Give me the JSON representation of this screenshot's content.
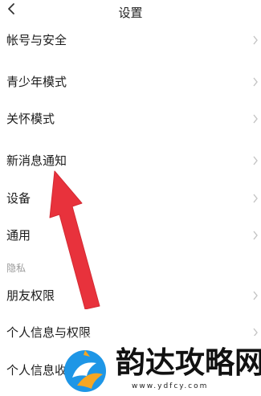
{
  "header": {
    "title": "设置"
  },
  "items": [
    {
      "label": "帐号与安全"
    },
    {
      "label": "青少年模式"
    },
    {
      "label": "关怀模式"
    },
    {
      "label": "新消息通知"
    },
    {
      "label": "设备"
    },
    {
      "label": "通用"
    }
  ],
  "privacy_section": {
    "title": "隐私",
    "items": [
      {
        "label": "朋友权限"
      },
      {
        "label": "个人信息与权限"
      },
      {
        "label": "个人信息收"
      }
    ]
  },
  "annotation": {
    "arrow_color": "#e8323c"
  },
  "watermark": {
    "name": "韵达攻略网",
    "url": "www.ydfcy.com"
  },
  "colors": {
    "text": "#1c1c1c",
    "chevron": "#c4c4c4",
    "section_text": "#9a9a9a",
    "logo_blue": "#1e96e6",
    "logo_orange": "#f5a623"
  }
}
